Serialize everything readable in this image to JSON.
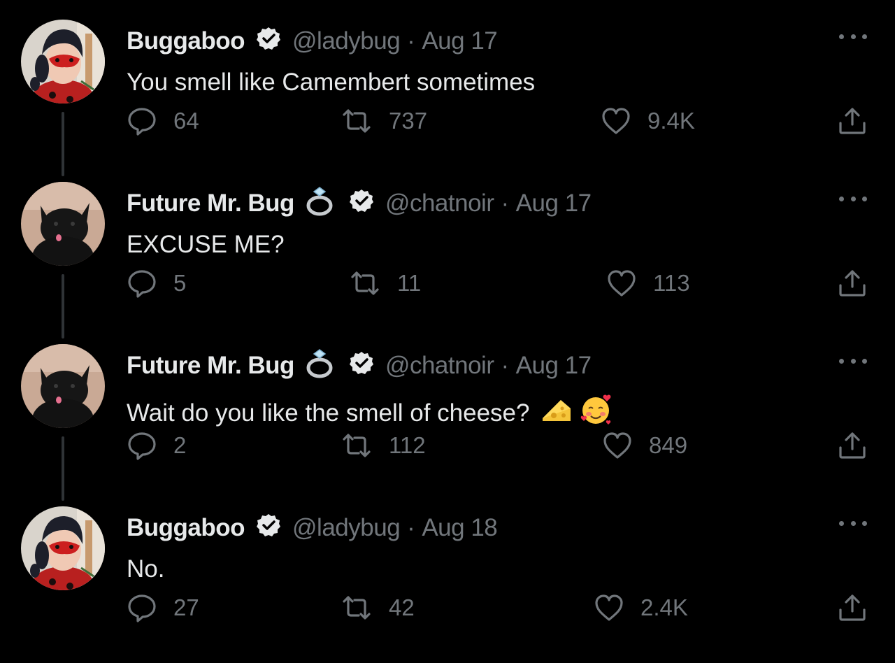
{
  "colors": {
    "background": "#000000",
    "text_primary": "#e7e9ea",
    "text_secondary": "#71767b",
    "thread_line": "#2f3336"
  },
  "tweets": [
    {
      "display_name": "Buggaboo",
      "has_ring": false,
      "handle": "@ladybug",
      "separator": "·",
      "date": "Aug 17",
      "text": "You smell like Camembert sometimes",
      "emojis": [],
      "avatar": "ladybug-avatar",
      "replies": "64",
      "retweets": "737",
      "likes": "9.4K"
    },
    {
      "display_name": "Future Mr. Bug",
      "has_ring": true,
      "handle": "@chatnoir",
      "separator": "·",
      "date": "Aug 17",
      "text": "EXCUSE ME?",
      "emojis": [],
      "avatar": "black-cat-avatar",
      "replies": "5",
      "retweets": "11",
      "likes": "113"
    },
    {
      "display_name": "Future Mr. Bug",
      "has_ring": true,
      "handle": "@chatnoir",
      "separator": "·",
      "date": "Aug 17",
      "text": "Wait do you like the smell of cheese?",
      "emojis": [
        "cheese-emoji",
        "smiling-face-with-hearts-emoji"
      ],
      "avatar": "black-cat-avatar",
      "replies": "2",
      "retweets": "112",
      "likes": "849"
    },
    {
      "display_name": "Buggaboo",
      "has_ring": false,
      "handle": "@ladybug",
      "separator": "·",
      "date": "Aug 18",
      "text": "No.",
      "emojis": [],
      "avatar": "ladybug-avatar",
      "replies": "27",
      "retweets": "42",
      "likes": "2.4K"
    }
  ]
}
